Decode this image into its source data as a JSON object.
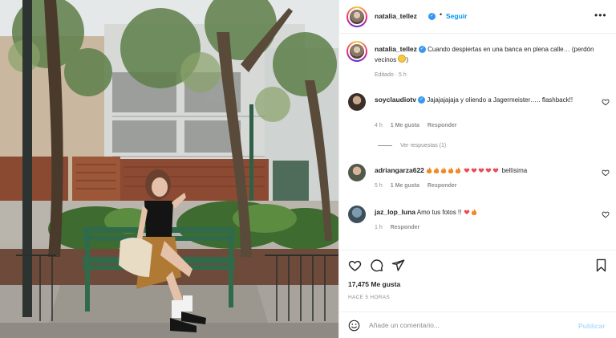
{
  "post": {
    "username": "natalia_tellez",
    "follow_label": "Seguir",
    "more_label": "•••",
    "separator": "•",
    "image_alt": "Photo of a woman sitting on a green park bench in a city street with trees and buildings"
  },
  "caption": {
    "username": "natalia_tellez",
    "text": "Cuando despiertas en una banca en plena calle… (perdón vecinos",
    "text_end": ")",
    "emoji": "grimacing-face",
    "edited_label": "Editado",
    "time": "5 h"
  },
  "comments": [
    {
      "username": "soyclaudiotv",
      "verified": true,
      "text": "Jajajajajaja y oliendo a Jagermeister….. flashback!!",
      "time": "4 h",
      "likes": "1 Me gusta",
      "reply_label": "Responder",
      "view_replies": "Ver respuestas (1)"
    },
    {
      "username": "adriangarza622",
      "text": "bellísima",
      "emojis": "fire fire fire fire fire heart heart heart heart heart",
      "time": "5 h",
      "likes": "1 Me gusta",
      "reply_label": "Responder"
    },
    {
      "username": "jaz_lop_luna",
      "text": "Amo tus fotos !!",
      "emojis": "heart fire",
      "time": "1 h",
      "reply_label": "Responder"
    }
  ],
  "actions": {
    "like_icon": "heart-icon",
    "comment_icon": "comment-icon",
    "share_icon": "share-icon",
    "save_icon": "bookmark-icon"
  },
  "likes_count": "17,475 Me gusta",
  "posted_ago": "HACE 5 HORAS",
  "add_comment": {
    "placeholder": "Añade un comentario...",
    "publish_label": "Publicar"
  },
  "colors": {
    "accent": "#0095f6",
    "verified": "#3897f0",
    "muted": "#8e8e8e",
    "publish_disabled": "#b3dbff",
    "heart_red": "#ed4956"
  }
}
